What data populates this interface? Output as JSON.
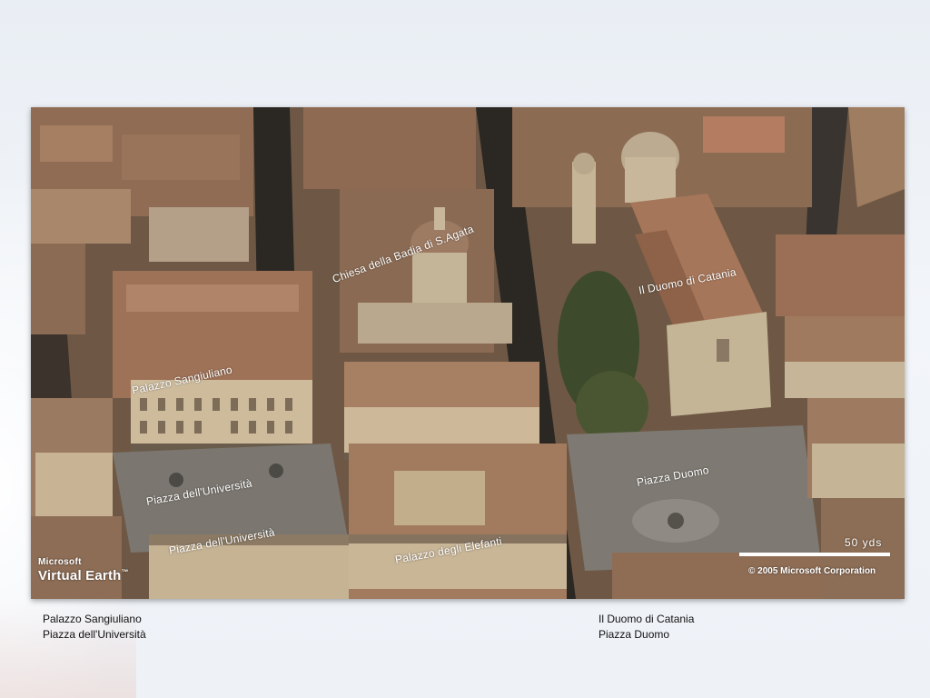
{
  "map": {
    "labels": {
      "chiesa_badia": "Chiesa della Badia di S.Agata",
      "duomo": "Il Duomo di Catania",
      "palazzo_sangiuliano": "Palazzo Sangiuliano",
      "piazza_universita": "Piazza dell'Università",
      "piazza_universita_2": "Piazza dell'Università",
      "piazza_duomo": "Piazza Duomo",
      "palazzo_elefanti": "Palazzo degli Elefanti"
    },
    "scale_label": "50 yds",
    "copyright": "© 2005 Microsoft Corporation",
    "logo_top": "Microsoft",
    "logo_main": "Virtual Earth",
    "logo_mark": "™"
  },
  "captions": {
    "left": [
      "Palazzo Sangiuliano",
      "Piazza dell'Università"
    ],
    "right": [
      "Il Duomo di Catania",
      "Piazza Duomo"
    ]
  },
  "colors": {
    "roof": "#a0785a",
    "roof_dark": "#7a5a44",
    "facade": "#c8b79a",
    "street": "#2a2622",
    "plaza": "#7b7770",
    "trees": "#3f4a2c",
    "label_text": "#ffffff"
  }
}
